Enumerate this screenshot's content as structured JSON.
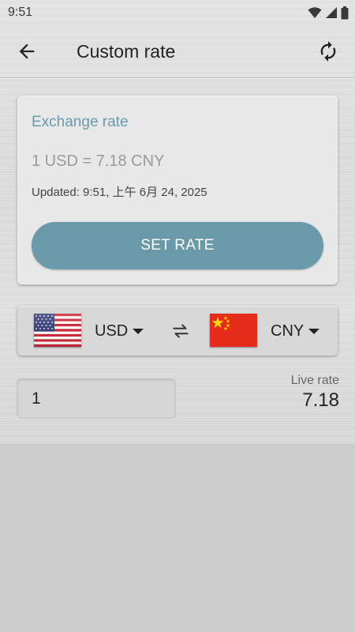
{
  "status_bar": {
    "time": "9:51",
    "icons": [
      "wifi-icon",
      "cellular-signal-icon",
      "battery-icon"
    ]
  },
  "app_bar": {
    "title": "Custom rate",
    "back_icon": "arrow-back-icon",
    "refresh_icon": "refresh-icon"
  },
  "rate_card": {
    "heading": "Exchange rate",
    "rate_text": "1 USD = 7.18 CNY",
    "updated_text": "Updated: 9:51, 上午 6月 24, 2025",
    "button_label": "SET RATE"
  },
  "currency_selector": {
    "from_code": "USD",
    "to_code": "CNY",
    "from_flag": "us-flag-icon",
    "to_flag": "china-flag-icon",
    "swap_icon": "swap-arrows-icon"
  },
  "amount": {
    "value": "1"
  },
  "live_rate": {
    "label": "Live rate",
    "value": "7.18"
  },
  "colors": {
    "accent": "#6a9aaa",
    "heading": "#6a9aae",
    "background": "#e0e0e0"
  }
}
